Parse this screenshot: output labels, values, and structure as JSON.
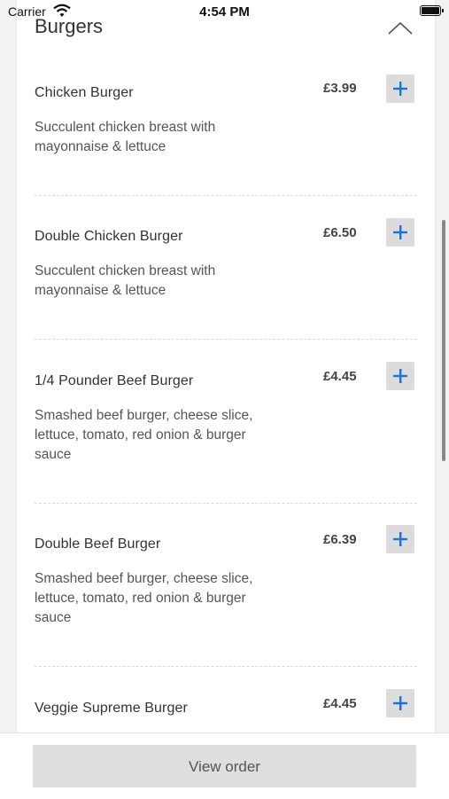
{
  "status_bar": {
    "carrier": "Carrier",
    "time": "4:54 PM"
  },
  "section": {
    "title": "Burgers"
  },
  "items": [
    {
      "name": "Chicken Burger",
      "price": "£3.99",
      "description": "Succulent chicken breast with mayonnaise & lettuce"
    },
    {
      "name": "Double Chicken Burger",
      "price": "£6.50",
      "description": "Succulent chicken breast with mayonnaise & lettuce"
    },
    {
      "name": "1/4 Pounder Beef Burger",
      "price": "£4.45",
      "description": "Smashed beef burger, cheese slice, lettuce, tomato, red onion & burger sauce"
    },
    {
      "name": "Double Beef Burger",
      "price": "£6.39",
      "description": "Smashed beef burger, cheese slice, lettuce, tomato, red onion & burger sauce"
    },
    {
      "name": "Veggie Supreme Burger",
      "price": "£4.45",
      "description": ""
    }
  ],
  "footer": {
    "button_label": "View order"
  },
  "icons": {
    "add": "plus-icon",
    "collapse": "chevron-up-icon",
    "wifi": "wifi-icon",
    "battery": "battery-icon"
  },
  "colors": {
    "accent": "#1a73d9",
    "button_bg": "#dcdcdc"
  }
}
